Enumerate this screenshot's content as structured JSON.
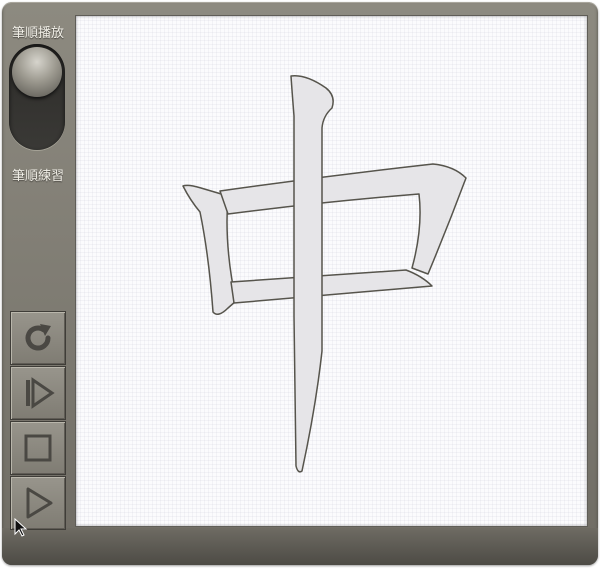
{
  "app": {
    "mode_labels": {
      "play": "筆順播放",
      "practice": "筆順練習"
    },
    "toggle": {
      "selected_mode": "play"
    },
    "controls": [
      {
        "icon": "reload-icon",
        "action": "replay"
      },
      {
        "icon": "step-forward-icon",
        "action": "next-stroke"
      },
      {
        "icon": "stop-icon",
        "action": "stop"
      },
      {
        "icon": "play-icon",
        "action": "play"
      }
    ],
    "character": {
      "glyph": "中",
      "stroke_fill": "#e6e5e8",
      "stroke_outline": "#56544c"
    },
    "colors": {
      "frame": "#7e7b72",
      "canvas": "#fbfbfd",
      "label_text": "#f2f0e8"
    }
  }
}
